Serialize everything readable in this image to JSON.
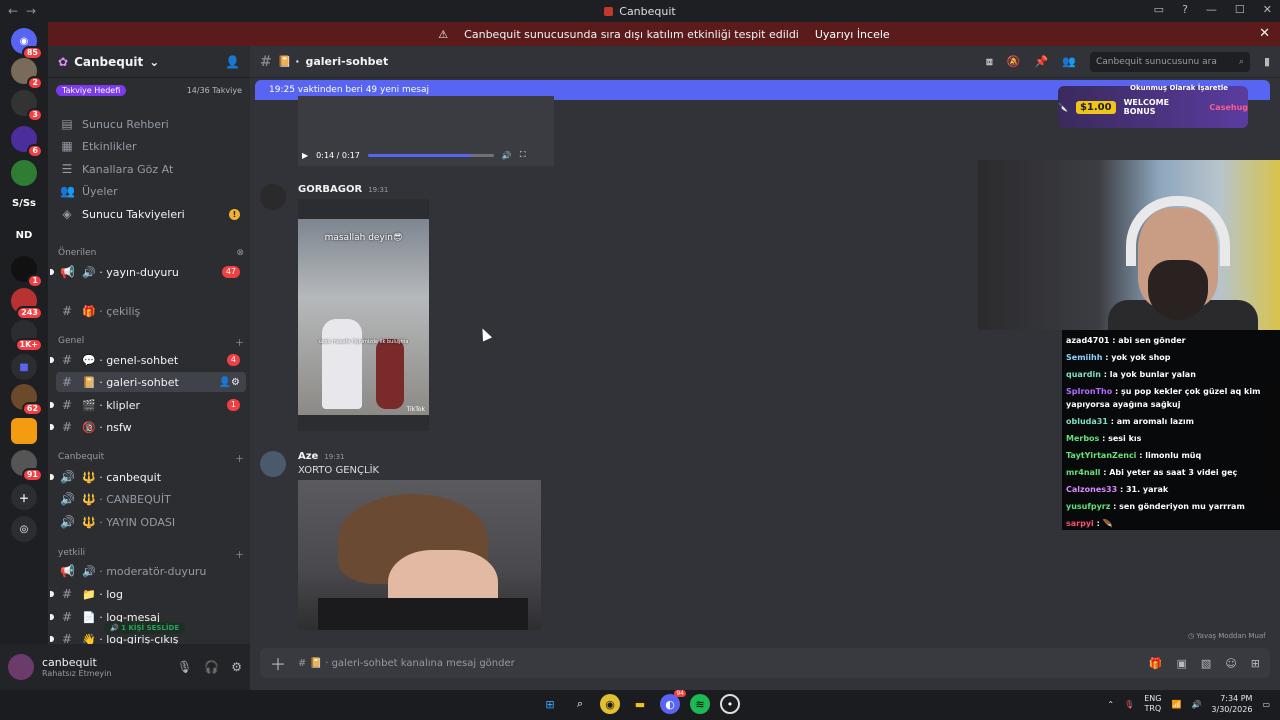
{
  "window": {
    "title": "Canbequit",
    "controls": [
      "▭",
      "?",
      "—",
      "☐",
      "✕"
    ]
  },
  "banner": {
    "text": "Canbequit sunucusunda sıra dışı katılım etkinliği tespit edildi",
    "action": "Uyarıyı İncele"
  },
  "guilds": [
    {
      "label": "",
      "badge": "85",
      "color": "#5865f2"
    },
    {
      "label": "",
      "badge": "2",
      "color": "#7a6a5a"
    },
    {
      "label": "",
      "badge": "3",
      "color": "#333333"
    },
    {
      "label": "",
      "badge": "6",
      "color": "#4b2d9c"
    },
    {
      "label": "",
      "badge": "",
      "color": "#2e7d32"
    },
    {
      "label": "S/Ss",
      "badge": "",
      "color": "#1e1f22"
    },
    {
      "label": "ND",
      "badge": "",
      "color": "#1e1f22"
    },
    {
      "label": "",
      "badge": "1",
      "color": "#111111"
    },
    {
      "label": "",
      "badge": "243",
      "color": "#b83232"
    },
    {
      "label": "",
      "badge": "1K+",
      "color": "#2b2d31"
    },
    {
      "label": "",
      "badge": "",
      "color": "#5865f2"
    },
    {
      "label": "",
      "badge": "62",
      "color": "#6b4a2a"
    },
    {
      "label": "",
      "badge": "",
      "color": "#f39c12"
    },
    {
      "label": "",
      "badge": "91",
      "color": "#555555"
    }
  ],
  "server": {
    "name": "Canbequit",
    "boost_label": "Takviye Hedefi",
    "boost_count": "14/36 Takviye",
    "nav": [
      "Sunucu Rehberi",
      "Etkinlikler",
      "Kanallara Göz At",
      "Üyeler",
      "Sunucu Takviyeleri"
    ],
    "categories": {
      "suggested": "Önerilen",
      "general": "Genel",
      "canbequit": "Canbequit",
      "yetkili": "yetkili"
    },
    "channels": {
      "yayin_duyuru": "yayın-duyuru",
      "yayin_duyuru_badge": "47",
      "cekilis": "çekiliş",
      "genel_sohbet": "genel-sohbet",
      "genel_sohbet_badge": "4",
      "galeri_sohbet": "galeri-sohbet",
      "klipler": "klipler",
      "klipler_badge": "1",
      "nsfw": "nsfw",
      "voice1": "canbequit",
      "voice2": "CANBEQUİT",
      "voice3": "YAYIN ODASI",
      "moderator": "moderatör-duyuru",
      "log": "log",
      "log_mesaj": "log-mesaj",
      "log_giris": "log-giriş-çıkış"
    },
    "voice_pill": "1 KİŞİ SESLİDE"
  },
  "user": {
    "name": "canbequit",
    "status": "Rahatsız Etmeyin"
  },
  "channel_header": {
    "name": "galeri-sohbet",
    "search_placeholder": "Canbequit sunucusunu ara"
  },
  "new_messages": "19:25 vaktinden beri 49 yeni mesaj",
  "ad": {
    "amount": "$1.00",
    "label": "WELCOME BONUS",
    "brand": "Casehug",
    "mark": "Okunmuş Olarak İşaretle"
  },
  "video": {
    "time": "0:14 / 0:17",
    "progress": 0.82
  },
  "messages": [
    {
      "author": "GORBAGOR",
      "time": "19:31",
      "text": "",
      "media_caption": "masallah deyin😎",
      "media_caption2": "uzak mesafe ilişkimizde ilk buluşma",
      "watermark": "TikTok"
    },
    {
      "author": "Aze",
      "time": "19:31",
      "text": "XORTO GENÇLİK"
    }
  ],
  "composer": {
    "placeholder": "galeri-sohbet kanalına mesaj gönder",
    "slowmode": "Yavaş Moddan Muaf"
  },
  "stream_chat": [
    {
      "user": "azad4701",
      "color": "#ffffff",
      "msg": "abi sen gönder"
    },
    {
      "user": "Semiihh",
      "color": "#8fd3ff",
      "msg": "yok yok shop"
    },
    {
      "user": "quardin",
      "color": "#7fe0c0",
      "msg": "la yok bunlar yalan"
    },
    {
      "user": "SpIronTho",
      "color": "#b06bff",
      "msg": "şu pop kekler çok güzel aq kim yapıyorsa ayağına sağkuj"
    },
    {
      "user": "obluda31",
      "color": "#7fe0c0",
      "msg": "am aromalı lazım"
    },
    {
      "user": "Merbos",
      "color": "#66e07a",
      "msg": "sesi kıs"
    },
    {
      "user": "TaytYirtanZenci",
      "color": "#66e07a",
      "msg": "limonlu müq"
    },
    {
      "user": "mr4nall",
      "color": "#66e07a",
      "msg": "Abi yeter as saat 3 videi geç"
    },
    {
      "user": "Calzones33",
      "color": "#d98cff",
      "msg": "31. yarak"
    },
    {
      "user": "yusufpyrz",
      "color": "#66e07a",
      "msg": "sen gönderiyon mu yarrram"
    },
    {
      "user": "sarpyi",
      "color": "#ff4d6d",
      "msg": "🪶"
    }
  ],
  "taskbar": {
    "lang1": "ENG",
    "lang2": "TRQ",
    "time": "7:34 PM",
    "date": "3/30/2026",
    "discord_badge": "94"
  }
}
